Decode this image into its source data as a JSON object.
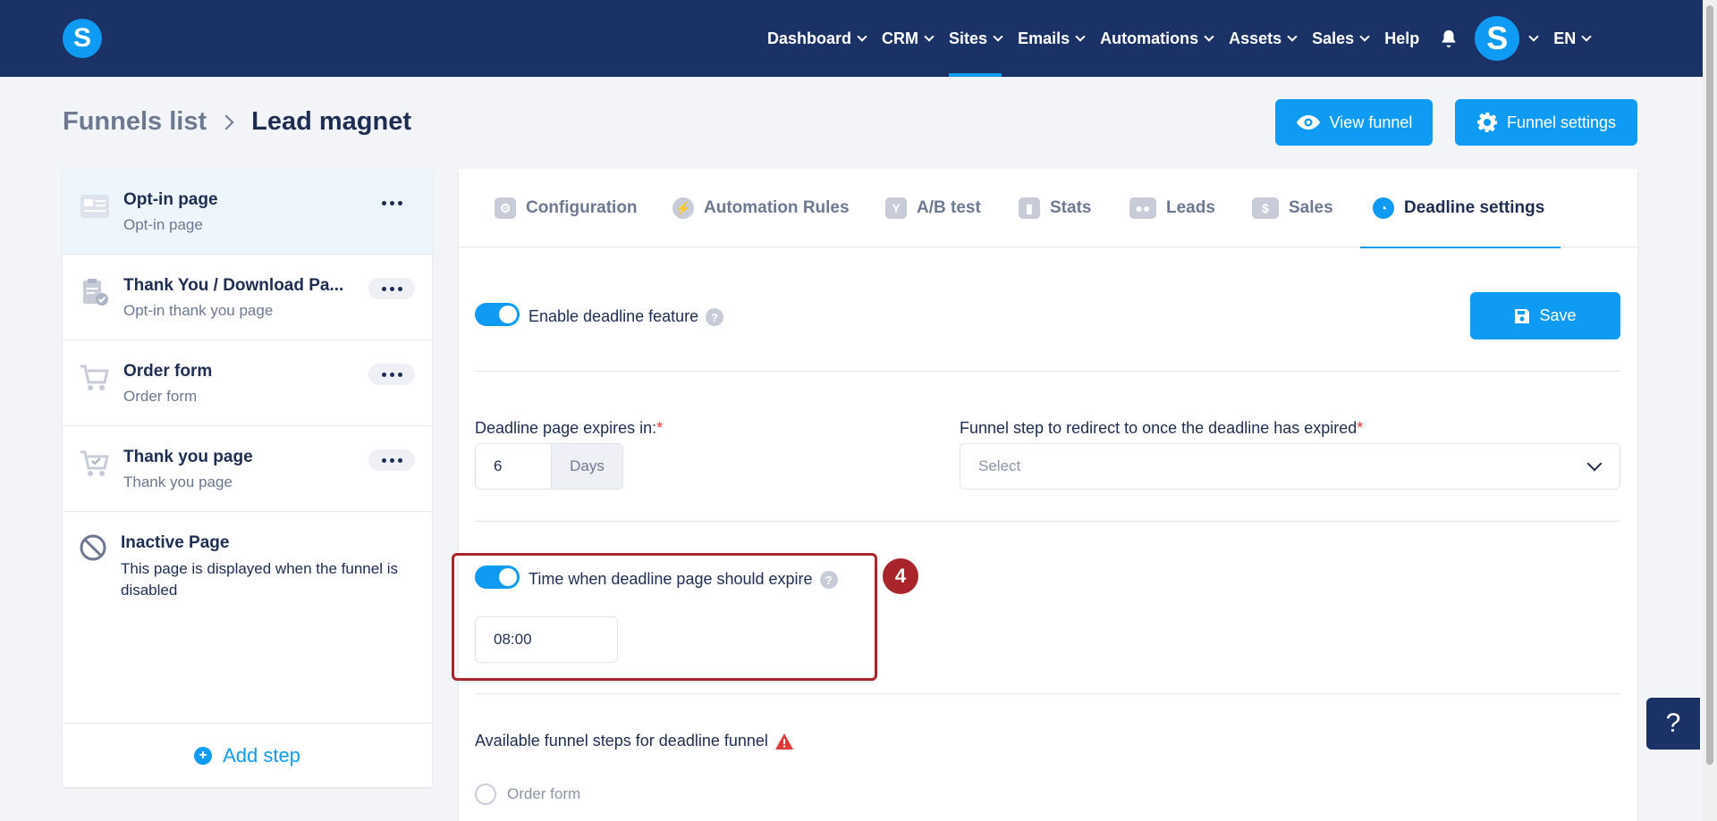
{
  "brand": {
    "logo_letter": "S"
  },
  "nav": {
    "items": [
      {
        "label": "Dashboard",
        "has_menu": true
      },
      {
        "label": "CRM",
        "has_menu": true
      },
      {
        "label": "Sites",
        "has_menu": true,
        "active": true
      },
      {
        "label": "Emails",
        "has_menu": true
      },
      {
        "label": "Automations",
        "has_menu": true
      },
      {
        "label": "Assets",
        "has_menu": true
      },
      {
        "label": "Sales",
        "has_menu": true
      },
      {
        "label": "Help",
        "has_menu": false
      }
    ],
    "avatar_letter": "S",
    "language": "EN"
  },
  "breadcrumb": {
    "parent": "Funnels list",
    "current": "Lead magnet"
  },
  "header_buttons": {
    "view_funnel": "View funnel",
    "funnel_settings": "Funnel settings"
  },
  "steps": [
    {
      "title": "Opt-in page",
      "subtitle": "Opt-in page",
      "icon": "page-layout-icon"
    },
    {
      "title": "Thank You / Download Pa...",
      "subtitle": "Opt-in thank you page",
      "icon": "clipboard-check-icon"
    },
    {
      "title": "Order form",
      "subtitle": "Order form",
      "icon": "cart-icon"
    },
    {
      "title": "Thank you page",
      "subtitle": "Thank you page",
      "icon": "cart-check-icon"
    }
  ],
  "inactive_page": {
    "title": "Inactive Page",
    "description": "This page is displayed when the funnel is disabled"
  },
  "add_step_label": "Add step",
  "tabs": [
    {
      "label": "Configuration",
      "icon": "sliders-icon"
    },
    {
      "label": "Automation Rules",
      "icon": "lightning-icon"
    },
    {
      "label": "A/B test",
      "icon": "split-icon"
    },
    {
      "label": "Stats",
      "icon": "bar-chart-icon"
    },
    {
      "label": "Leads",
      "icon": "users-icon"
    },
    {
      "label": "Sales",
      "icon": "dollar-icon"
    },
    {
      "label": "Deadline settings",
      "icon": "clock-icon",
      "active": true
    }
  ],
  "deadline": {
    "enable_label": "Enable deadline feature",
    "save_label": "Save",
    "expires_label": "Deadline page expires in:",
    "expires_value": "6",
    "expires_unit": "Days",
    "redirect_label": "Funnel step to redirect to once the deadline has expired",
    "redirect_placeholder": "Select",
    "time_label": "Time when deadline page should expire",
    "time_value": "08:00",
    "available_steps_label": "Available funnel steps for deadline funnel",
    "available_steps": [
      "Order form"
    ]
  },
  "annotation": {
    "step_number": "4"
  },
  "help_fab": "?",
  "help_mark": "?",
  "required_mark": "*",
  "colors": {
    "navbar": "#1a3265",
    "accent": "#0f9bf3",
    "annotation": "#a8262b"
  }
}
